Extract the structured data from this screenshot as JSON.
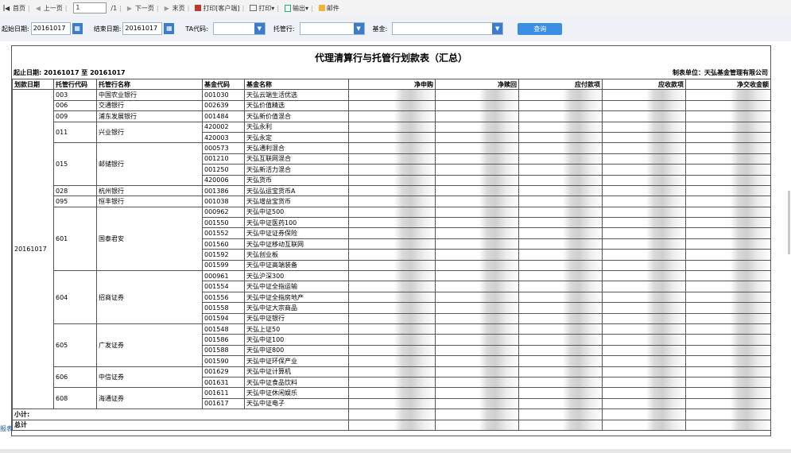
{
  "toolbar": {
    "first": "首页",
    "prev": "上一页",
    "page_value": "1",
    "page_total": "/1",
    "next": "下一页",
    "last": "末页",
    "print_client": "打印[客户端]",
    "print": "打印",
    "export": "输出",
    "mail": "邮件"
  },
  "filters": {
    "start_label": "起始日期:",
    "start_value": "20161017",
    "end_label": "结束日期:",
    "end_value": "20161017",
    "ta_label": "TA代码:",
    "custodian_label": "托管行:",
    "fund_label": "基金:",
    "query_button": "查询"
  },
  "report": {
    "title": "代理清算行与托管行划款表（汇总）",
    "period": "起止日期: 20161017 至 20161017",
    "unit": "制表单位：天弘基金管理有限公司",
    "headers": [
      "划款日期",
      "托管行代码",
      "托管行名称",
      "基金代码",
      "基金名称",
      "净申购",
      "净赎回",
      "应付款项",
      "应收款项",
      "净交收金额"
    ],
    "date": "20161017",
    "groups": [
      {
        "code": "003",
        "name": "中国农业银行",
        "funds": [
          [
            "001030",
            "天弘云端生活优选"
          ]
        ]
      },
      {
        "code": "006",
        "name": "交通银行",
        "funds": [
          [
            "002639",
            "天弘价值精选"
          ]
        ]
      },
      {
        "code": "009",
        "name": "浦东发展银行",
        "funds": [
          [
            "001484",
            "天弘新价值混合"
          ]
        ]
      },
      {
        "code": "011",
        "name": "兴业银行",
        "funds": [
          [
            "420002",
            "天弘永利"
          ],
          [
            "420003",
            "天弘永定"
          ]
        ]
      },
      {
        "code": "015",
        "name": "邮储银行",
        "funds": [
          [
            "000573",
            "天弘通利混合"
          ],
          [
            "001210",
            "天弘互联网混合"
          ],
          [
            "001250",
            "天弘新活力混合"
          ],
          [
            "420006",
            "天弘货币"
          ]
        ]
      },
      {
        "code": "028",
        "name": "杭州银行",
        "funds": [
          [
            "001386",
            "天弘弘运宝货币A"
          ]
        ]
      },
      {
        "code": "095",
        "name": "恒丰银行",
        "funds": [
          [
            "001038",
            "天弘增益宝货币"
          ]
        ]
      },
      {
        "code": "601",
        "name": "国泰君安",
        "funds": [
          [
            "000962",
            "天弘中证500"
          ],
          [
            "001550",
            "天弘中证医药100"
          ],
          [
            "001552",
            "天弘中证证券保险"
          ],
          [
            "001560",
            "天弘中证移动互联网"
          ],
          [
            "001592",
            "天弘创业板"
          ],
          [
            "001599",
            "天弘中证高端装备"
          ]
        ]
      },
      {
        "code": "604",
        "name": "招商证券",
        "funds": [
          [
            "000961",
            "天弘沪深300"
          ],
          [
            "001554",
            "天弘中证全指运输"
          ],
          [
            "001556",
            "天弘中证全指房地产"
          ],
          [
            "001558",
            "天弘中证大宗商品"
          ],
          [
            "001594",
            "天弘中证银行"
          ]
        ]
      },
      {
        "code": "605",
        "name": "广发证券",
        "funds": [
          [
            "001548",
            "天弘上证50"
          ],
          [
            "001586",
            "天弘中证100"
          ],
          [
            "001588",
            "天弘中证800"
          ],
          [
            "001590",
            "天弘中证环保产业"
          ]
        ]
      },
      {
        "code": "606",
        "name": "中信证券",
        "funds": [
          [
            "001629",
            "天弘中证计算机"
          ],
          [
            "001631",
            "天弘中证食品饮料"
          ]
        ]
      },
      {
        "code": "608",
        "name": "海通证券",
        "funds": [
          [
            "001611",
            "天弘中证休闲娱乐"
          ],
          [
            "001617",
            "天弘中证电子"
          ]
        ]
      }
    ],
    "subtotal_label": "小计:",
    "total_label": "总计"
  },
  "side_link": "报表",
  "colors": {
    "accent": "#3b7cd1",
    "query": "#3a8ee6",
    "filter_bg": "#eef2f7"
  }
}
